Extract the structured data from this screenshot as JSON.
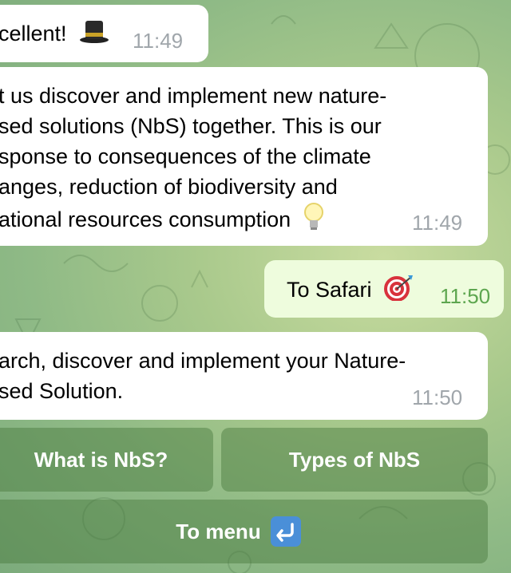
{
  "messages": [
    {
      "side": "in",
      "lines": [
        "cellent!"
      ],
      "emoji": "top-hat-icon",
      "time": "11:49"
    },
    {
      "side": "in",
      "lines": [
        "t us discover and implement new nature-",
        "sed solutions (NbS) together. This is our",
        "sponse to consequences of the climate",
        "anges, reduction of biodiversity and",
        "ational resources consumption"
      ],
      "emoji": "light-bulb-icon",
      "time": "11:49"
    },
    {
      "side": "out",
      "lines": [
        "To Safari"
      ],
      "emoji": "target-icon",
      "time": "11:50"
    },
    {
      "side": "in",
      "lines": [
        "arch, discover and implement your Nature-",
        "sed Solution."
      ],
      "time": "11:50"
    }
  ],
  "keyboard": {
    "what_is_nbs": "What is NbS?",
    "types_of_nbs": "Types of NbS",
    "to_menu": "To menu",
    "to_menu_icon": "return-arrow-icon"
  },
  "colors": {
    "incoming_bubble": "#ffffff",
    "outgoing_bubble": "#eefcdd",
    "outgoing_time": "#5da64f",
    "incoming_time": "#a0a6ab"
  }
}
